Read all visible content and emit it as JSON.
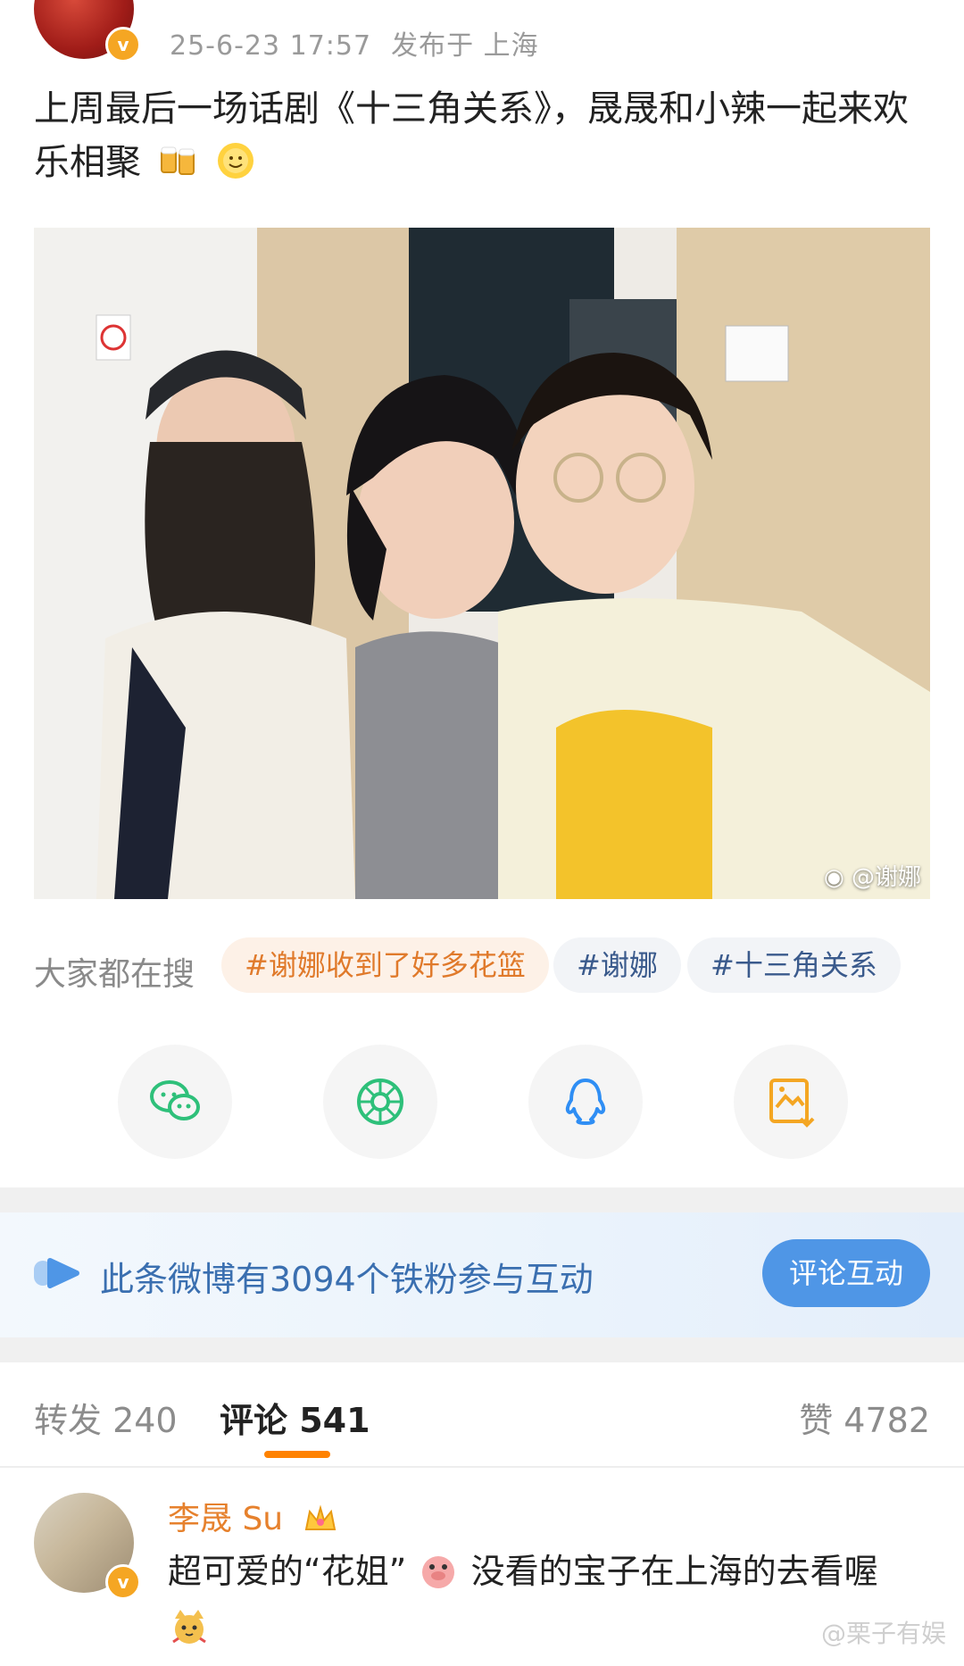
{
  "post": {
    "date": "25-6-23 17:57",
    "location": "发布于 上海",
    "text": "上周最后一场话剧《十三角关系》，晟晟和小辣一起来欢乐相聚",
    "photo_watermark": "@谢娜"
  },
  "hot_search": {
    "label": "大家都在搜",
    "chips": [
      "#谢娜收到了好多花篮",
      "#谢娜",
      "#十三角关系"
    ]
  },
  "share": {
    "icons": [
      "wechat-icon",
      "moments-icon",
      "qq-icon",
      "save-image-icon"
    ]
  },
  "fan_banner": {
    "text": "此条微博有3094个铁粉参与互动",
    "button": "评论互动"
  },
  "tabs": {
    "repost": "转发 240",
    "comments": "评论 541",
    "likes": "赞 4782"
  },
  "comment": {
    "author": "李晟 Su",
    "text_a": "超可爱的“花姐”",
    "text_b": "没看的宝子在上海的去看喔"
  },
  "page_watermark": "@栗子有娱",
  "colors": {
    "accent": "#ff8200",
    "link": "#3a6fb0",
    "button": "#4f96e6",
    "hot_chip": "#e07a2b"
  }
}
